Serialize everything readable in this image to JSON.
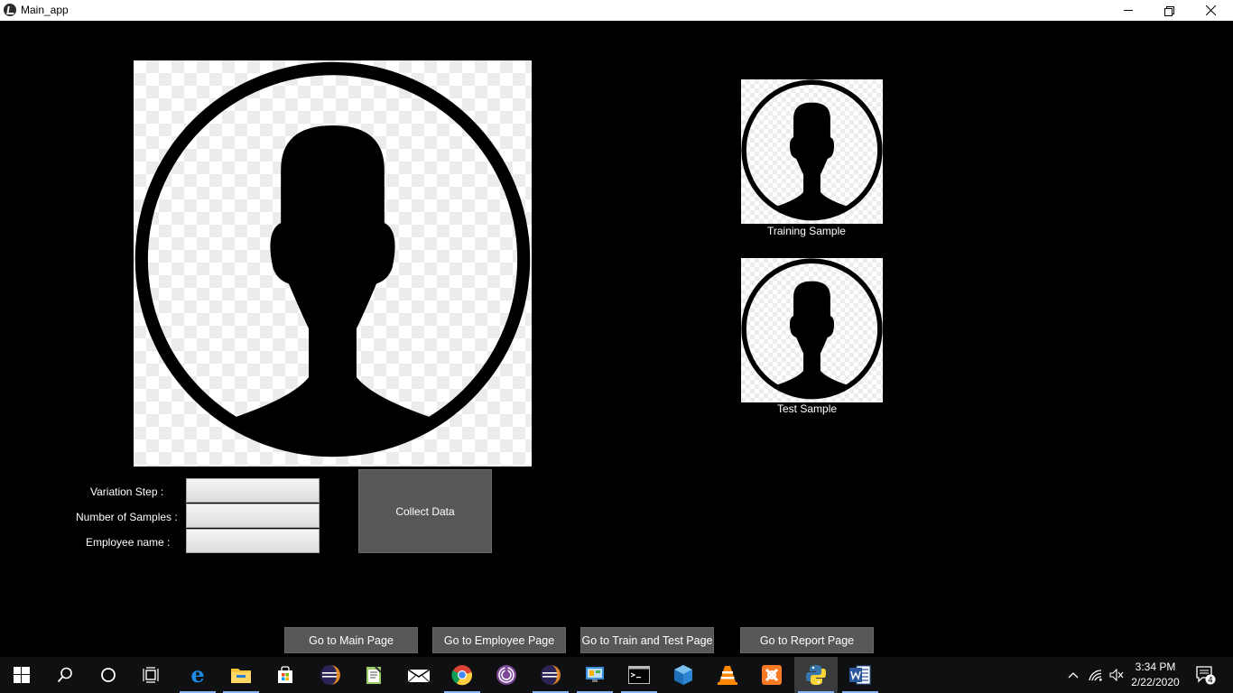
{
  "window": {
    "title": "Main_app",
    "icon": "kivy-app-icon",
    "controls": [
      "minimize-icon",
      "restore-icon",
      "close-icon"
    ]
  },
  "images": {
    "main": {
      "icon": "avatar-placeholder-icon"
    },
    "training": {
      "icon": "avatar-placeholder-icon",
      "caption": "Training Sample"
    },
    "test": {
      "icon": "avatar-placeholder-icon",
      "caption": "Test Sample"
    }
  },
  "form": {
    "variation_step": {
      "label": "Variation Step :",
      "value": ""
    },
    "num_samples": {
      "label": "Number of Samples :",
      "value": ""
    },
    "employee_name": {
      "label": "Employee name :",
      "value": ""
    },
    "collect_button": "Collect Data"
  },
  "nav": {
    "main": "Go to Main Page",
    "employee": "Go to Employee Page",
    "train_test": "Go to Train and Test Page",
    "report": "Go to Report Page"
  },
  "taskbar": {
    "apps": [
      "windows-start-icon",
      "search-icon",
      "cortana-icon",
      "task-view-icon",
      "edge-icon",
      "file-explorer-icon",
      "store-icon",
      "eclipse-icon",
      "notepad-icon",
      "mail-icon",
      "chrome-icon",
      "tor-icon",
      "eclipse-icon",
      "control-panel-icon",
      "terminal-icon",
      "virtualbox-icon",
      "vlc-icon",
      "xampp-icon",
      "python-icon",
      "word-icon"
    ],
    "tray": [
      "chevron-up-icon",
      "wifi-icon",
      "volume-muted-icon"
    ],
    "time": "3:34 PM",
    "date": "2/22/2020",
    "notification_count": "4"
  },
  "colors": {
    "background": "#000000",
    "button": "#575757",
    "titlebar": "#ffffff",
    "taskbar": "#0f1011",
    "taskbar_running": "#8ab4f8"
  }
}
